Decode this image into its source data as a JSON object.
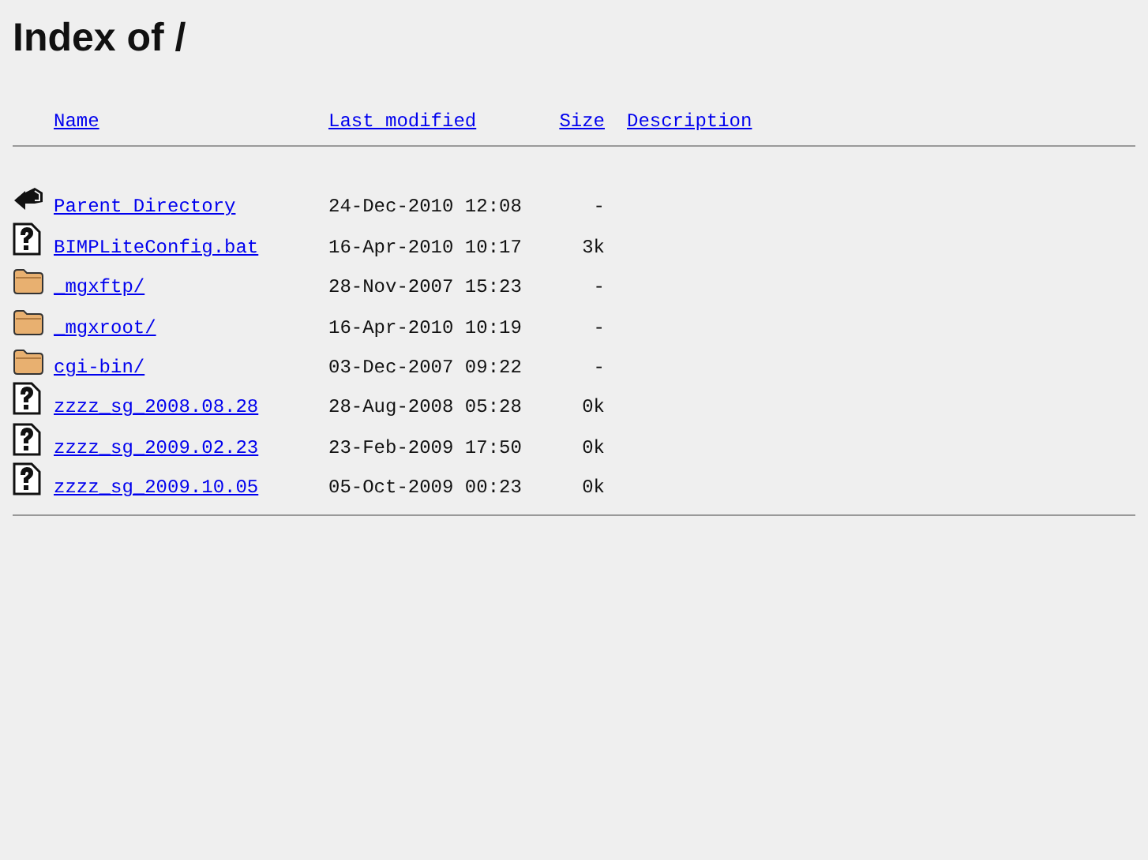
{
  "title": "Index of /",
  "columns": [
    "Name",
    "Last modified",
    "Size",
    "Description"
  ],
  "rows": [
    {
      "kind": "parent",
      "name": "Parent Directory",
      "modified": "24-Dec-2010 12:08",
      "size": "-"
    },
    {
      "kind": "file",
      "name": "BIMPLiteConfig.bat",
      "modified": "16-Apr-2010 10:17",
      "size": "3k"
    },
    {
      "kind": "folder",
      "name": "_mgxftp/",
      "modified": "28-Nov-2007 15:23",
      "size": "-"
    },
    {
      "kind": "folder",
      "name": "_mgxroot/",
      "modified": "16-Apr-2010 10:19",
      "size": "-"
    },
    {
      "kind": "folder",
      "name": "cgi-bin/",
      "modified": "03-Dec-2007 09:22",
      "size": "-"
    },
    {
      "kind": "file",
      "name": "zzzz_sg_2008.08.28",
      "modified": "28-Aug-2008 05:28",
      "size": "0k"
    },
    {
      "kind": "file",
      "name": "zzzz_sg_2009.02.23",
      "modified": "23-Feb-2009 17:50",
      "size": "0k"
    },
    {
      "kind": "file",
      "name": "zzzz_sg_2009.10.05",
      "modified": "05-Oct-2009 00:23",
      "size": "0k"
    }
  ]
}
